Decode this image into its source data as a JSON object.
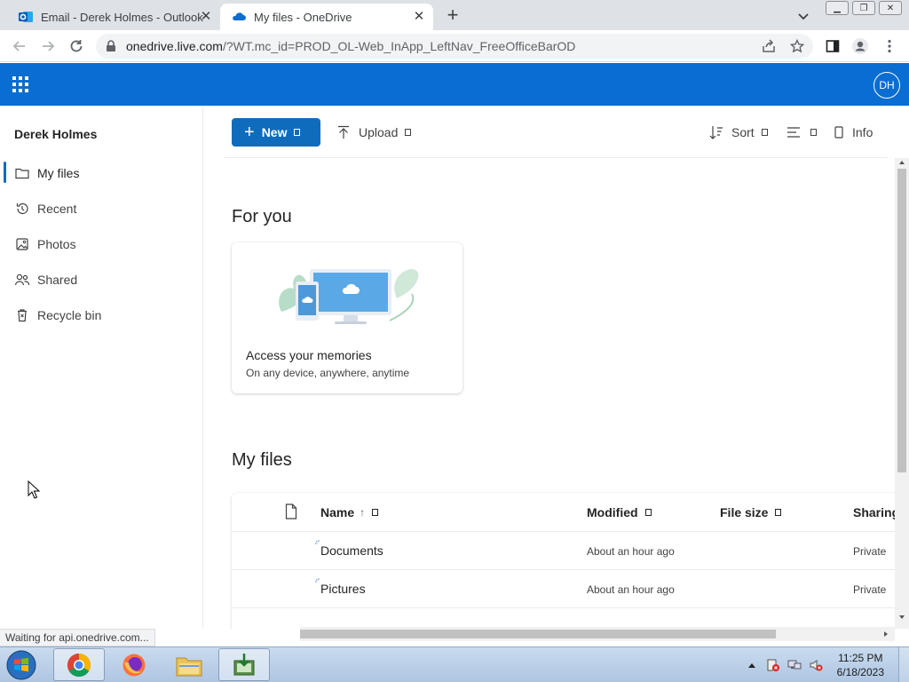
{
  "browser": {
    "tabs": [
      {
        "title": "Email - Derek Holmes - Outlook",
        "favicon": "outlook-icon",
        "active": false
      },
      {
        "title": "My files - OneDrive",
        "favicon": "onedrive-cloud-icon",
        "active": true
      }
    ],
    "address": {
      "host": "onedrive.live.com",
      "path": "/?WT.mc_id=PROD_OL-Web_InApp_LeftNav_FreeOfficeBarOD"
    },
    "status_text": "Waiting for api.onedrive.com..."
  },
  "header": {
    "avatar_initials": "DH",
    "brand_color": "#0a6dd1"
  },
  "leftnav": {
    "user_name": "Derek Holmes",
    "items": [
      {
        "label": "My files",
        "icon": "folder-icon",
        "selected": true
      },
      {
        "label": "Recent",
        "icon": "history-icon",
        "selected": false
      },
      {
        "label": "Photos",
        "icon": "image-icon",
        "selected": false
      },
      {
        "label": "Shared",
        "icon": "people-icon",
        "selected": false
      },
      {
        "label": "Recycle bin",
        "icon": "trash-icon",
        "selected": false
      }
    ]
  },
  "commandbar": {
    "new_label": "New",
    "upload_label": "Upload",
    "sort_label": "Sort",
    "info_label": "Info"
  },
  "foryou": {
    "heading": "For you",
    "card_title": "Access your memories",
    "card_subtitle": "On any device, anywhere, anytime"
  },
  "myfiles": {
    "heading": "My files",
    "columns": {
      "name": "Name",
      "modified": "Modified",
      "file_size": "File size",
      "sharing": "Sharing"
    },
    "rows": [
      {
        "name": "Documents",
        "modified": "About an hour ago",
        "size": "",
        "sharing": "Private"
      },
      {
        "name": "Pictures",
        "modified": "About an hour ago",
        "size": "",
        "sharing": "Private"
      }
    ]
  },
  "taskbar": {
    "time": "11:25 PM",
    "date": "6/18/2023"
  }
}
